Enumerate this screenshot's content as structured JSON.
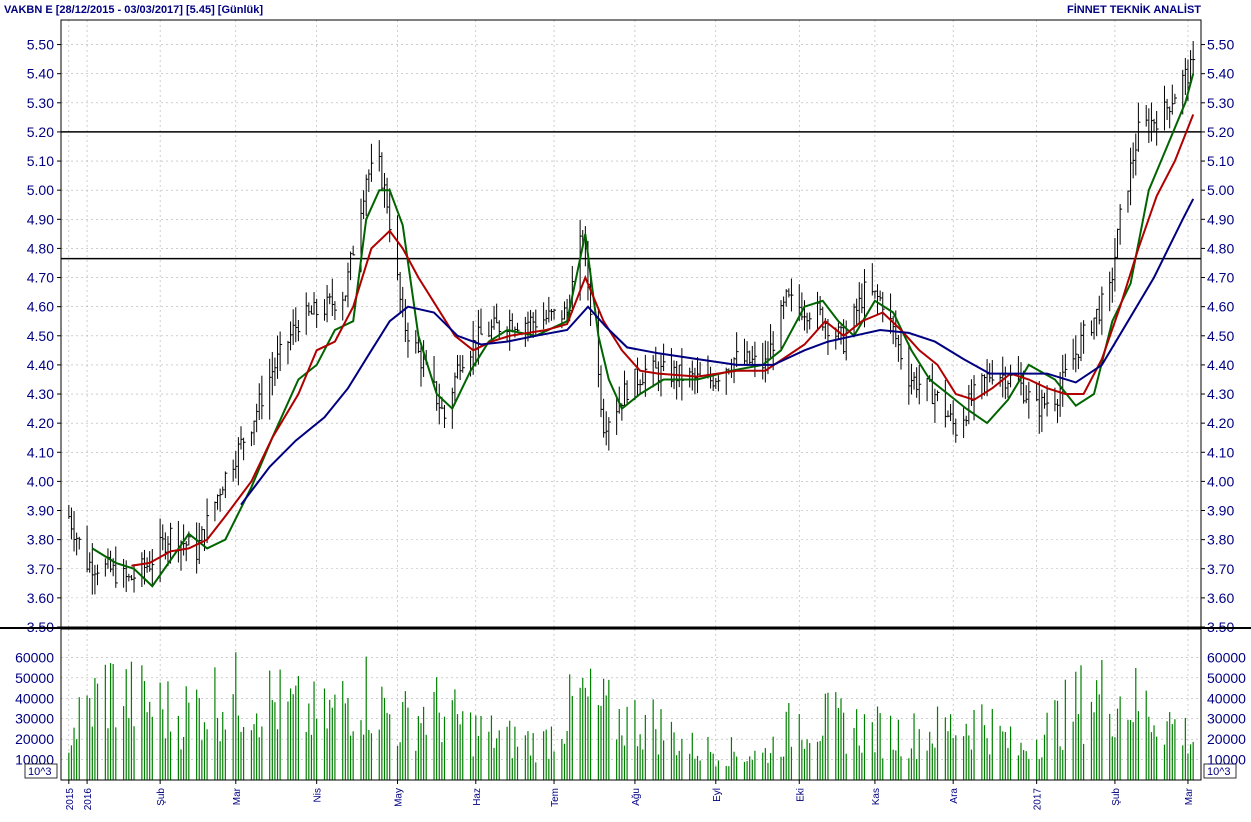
{
  "header": {
    "title": "VAKBN E  [28/12/2015 - 03/03/2017]  [5.45]  [Günlük]",
    "brand": "FİNNET TEKNİK ANALİST"
  },
  "colors": {
    "price_bars": "#000000",
    "ma_fast": "#006400",
    "ma_mid": "#b00000",
    "ma_slow": "#000080",
    "volume": "#008000",
    "grid": "#b0b0b0",
    "axis_text": "#000080"
  },
  "chart_data": [
    {
      "type": "line",
      "panel": "price",
      "title": "VAKBN E  [28/12/2015 - 03/03/2017]  [5.45]  [Günlük]",
      "ylim": [
        3.5,
        5.55
      ],
      "y_ticks": [
        "3.50",
        "3.60",
        "3.70",
        "3.80",
        "3.90",
        "4.00",
        "4.10",
        "4.20",
        "4.30",
        "4.40",
        "4.50",
        "4.60",
        "4.70",
        "4.80",
        "4.90",
        "5.00",
        "5.10",
        "5.20",
        "5.30",
        "5.40",
        "5.50"
      ],
      "x_tick_labels": [
        "2015",
        "2016",
        "Şub",
        "Mar",
        "Nis",
        "May",
        "Haz",
        "Tem",
        "Ağu",
        "Eyl",
        "Eki",
        "Kas",
        "Ara",
        "2017",
        "Şub",
        "Mar"
      ],
      "x_tick_dates": [
        "2015-12-28",
        "2016-01-04",
        "2016-02-01",
        "2016-03-01",
        "2016-04-01",
        "2016-05-02",
        "2016-06-01",
        "2016-07-01",
        "2016-08-01",
        "2016-09-01",
        "2016-10-03",
        "2016-11-01",
        "2016-12-01",
        "2017-01-02",
        "2017-02-01",
        "2017-03-01"
      ],
      "horizontal_lines": [
        5.2,
        4.765
      ],
      "price_series": {
        "dates": [
          "2015-12-28",
          "2016-01-04",
          "2016-01-12",
          "2016-01-20",
          "2016-01-28",
          "2016-02-05",
          "2016-02-15",
          "2016-02-25",
          "2016-03-07",
          "2016-03-15",
          "2016-03-25",
          "2016-04-05",
          "2016-04-12",
          "2016-04-20",
          "2016-04-25",
          "2016-04-28",
          "2016-05-04",
          "2016-05-12",
          "2016-05-20",
          "2016-05-26",
          "2016-06-03",
          "2016-06-13",
          "2016-06-24",
          "2016-07-06",
          "2016-07-12",
          "2016-07-15",
          "2016-07-20",
          "2016-07-25",
          "2016-07-29",
          "2016-08-05",
          "2016-08-15",
          "2016-08-29",
          "2016-09-08",
          "2016-09-20",
          "2016-09-28",
          "2016-10-03",
          "2016-10-10",
          "2016-10-20",
          "2016-10-28",
          "2016-11-04",
          "2016-11-14",
          "2016-11-24",
          "2016-12-02",
          "2016-12-08",
          "2016-12-16",
          "2016-12-26",
          "2017-01-02",
          "2017-01-10",
          "2017-01-20",
          "2017-01-30",
          "2017-02-03",
          "2017-02-10",
          "2017-02-20",
          "2017-02-27",
          "2017-03-03"
        ],
        "values": [
          3.88,
          3.72,
          3.7,
          3.66,
          3.72,
          3.82,
          3.76,
          4.0,
          4.2,
          4.38,
          4.55,
          4.6,
          4.65,
          5.05,
          5.08,
          4.96,
          4.55,
          4.4,
          4.22,
          4.42,
          4.5,
          4.55,
          4.55,
          4.58,
          4.85,
          4.6,
          4.2,
          4.26,
          4.32,
          4.38,
          4.37,
          4.34,
          4.42,
          4.4,
          4.62,
          4.6,
          4.58,
          4.48,
          4.65,
          4.62,
          4.36,
          4.3,
          4.18,
          4.28,
          4.38,
          4.34,
          4.25,
          4.3,
          4.5,
          4.65,
          4.9,
          5.2,
          5.27,
          5.38,
          5.42
        ]
      },
      "series": [
        {
          "dates": [
            "2016-01-06",
            "2016-01-15",
            "2016-01-22",
            "2016-01-29",
            "2016-02-05",
            "2016-02-12",
            "2016-02-19",
            "2016-02-26",
            "2016-03-07",
            "2016-03-15",
            "2016-03-25",
            "2016-04-01",
            "2016-04-08",
            "2016-04-15",
            "2016-04-20",
            "2016-04-25",
            "2016-04-29",
            "2016-05-04",
            "2016-05-10",
            "2016-05-17",
            "2016-05-23",
            "2016-05-30",
            "2016-06-06",
            "2016-06-13",
            "2016-06-24",
            "2016-07-06",
            "2016-07-13",
            "2016-07-18",
            "2016-07-22",
            "2016-07-27",
            "2016-08-03",
            "2016-08-12",
            "2016-08-25",
            "2016-09-07",
            "2016-09-19",
            "2016-09-26",
            "2016-10-05",
            "2016-10-12",
            "2016-10-18",
            "2016-10-24",
            "2016-11-01",
            "2016-11-08",
            "2016-11-15",
            "2016-11-22",
            "2016-11-29",
            "2016-12-06",
            "2016-12-14",
            "2016-12-22",
            "2016-12-30",
            "2017-01-09",
            "2017-01-17",
            "2017-01-24",
            "2017-01-31",
            "2017-02-07",
            "2017-02-14",
            "2017-02-21",
            "2017-02-28",
            "2017-03-03"
          ],
          "values": [
            3.77,
            3.72,
            3.7,
            3.64,
            3.73,
            3.82,
            3.77,
            3.8,
            3.98,
            4.15,
            4.35,
            4.4,
            4.52,
            4.55,
            4.9,
            5.0,
            5.0,
            4.88,
            4.5,
            4.3,
            4.25,
            4.38,
            4.48,
            4.52,
            4.5,
            4.55,
            4.85,
            4.5,
            4.35,
            4.25,
            4.3,
            4.35,
            4.35,
            4.38,
            4.4,
            4.45,
            4.6,
            4.62,
            4.55,
            4.5,
            4.62,
            4.58,
            4.45,
            4.35,
            4.3,
            4.25,
            4.2,
            4.28,
            4.4,
            4.35,
            4.26,
            4.3,
            4.55,
            4.68,
            5.0,
            5.15,
            5.3,
            5.4
          ]
        },
        {
          "dates": [
            "2016-01-21",
            "2016-01-28",
            "2016-02-05",
            "2016-02-12",
            "2016-02-19",
            "2016-02-26",
            "2016-03-07",
            "2016-03-15",
            "2016-03-25",
            "2016-04-01",
            "2016-04-08",
            "2016-04-15",
            "2016-04-22",
            "2016-04-29",
            "2016-05-04",
            "2016-05-10",
            "2016-05-17",
            "2016-05-24",
            "2016-05-31",
            "2016-06-07",
            "2016-06-14",
            "2016-06-28",
            "2016-07-06",
            "2016-07-13",
            "2016-07-20",
            "2016-07-27",
            "2016-08-03",
            "2016-08-10",
            "2016-08-25",
            "2016-09-09",
            "2016-09-20",
            "2016-10-05",
            "2016-10-13",
            "2016-10-20",
            "2016-10-27",
            "2016-11-04",
            "2016-11-11",
            "2016-11-18",
            "2016-11-25",
            "2016-12-02",
            "2016-12-09",
            "2016-12-16",
            "2016-12-23",
            "2016-12-30",
            "2017-01-06",
            "2017-01-13",
            "2017-01-20",
            "2017-01-27",
            "2017-02-03",
            "2017-02-10",
            "2017-02-17",
            "2017-02-24",
            "2017-03-03"
          ],
          "values": [
            3.71,
            3.72,
            3.76,
            3.77,
            3.8,
            3.88,
            4.0,
            4.15,
            4.3,
            4.45,
            4.48,
            4.6,
            4.8,
            4.86,
            4.8,
            4.7,
            4.6,
            4.5,
            4.45,
            4.48,
            4.5,
            4.52,
            4.54,
            4.7,
            4.55,
            4.45,
            4.38,
            4.37,
            4.36,
            4.38,
            4.38,
            4.47,
            4.55,
            4.5,
            4.55,
            4.58,
            4.52,
            4.45,
            4.4,
            4.3,
            4.28,
            4.32,
            4.37,
            4.35,
            4.32,
            4.3,
            4.3,
            4.42,
            4.6,
            4.8,
            4.98,
            5.1,
            5.26
          ]
        },
        {
          "dates": [
            "2016-03-03",
            "2016-03-14",
            "2016-03-24",
            "2016-04-04",
            "2016-04-13",
            "2016-04-22",
            "2016-04-29",
            "2016-05-06",
            "2016-05-16",
            "2016-05-25",
            "2016-06-03",
            "2016-06-13",
            "2016-06-24",
            "2016-07-06",
            "2016-07-14",
            "2016-07-21",
            "2016-07-29",
            "2016-08-10",
            "2016-08-25",
            "2016-09-09",
            "2016-09-23",
            "2016-10-05",
            "2016-10-14",
            "2016-10-24",
            "2016-11-03",
            "2016-11-14",
            "2016-11-24",
            "2016-12-05",
            "2016-12-15",
            "2016-12-26",
            "2017-01-06",
            "2017-01-17",
            "2017-01-27",
            "2017-02-06",
            "2017-02-16",
            "2017-02-27",
            "2017-03-03"
          ],
          "values": [
            3.92,
            4.05,
            4.14,
            4.22,
            4.32,
            4.45,
            4.55,
            4.6,
            4.58,
            4.5,
            4.47,
            4.48,
            4.5,
            4.52,
            4.6,
            4.53,
            4.46,
            4.44,
            4.42,
            4.4,
            4.4,
            4.45,
            4.48,
            4.5,
            4.52,
            4.51,
            4.48,
            4.42,
            4.37,
            4.37,
            4.37,
            4.34,
            4.4,
            4.55,
            4.7,
            4.9,
            4.97
          ]
        }
      ]
    },
    {
      "type": "bar",
      "panel": "volume",
      "ylim": [
        0,
        70000
      ],
      "y_ticks": [
        "10000",
        "20000",
        "30000",
        "40000",
        "50000",
        "60000"
      ],
      "unit_label": "10^3",
      "dates": [
        "2015-12-28",
        "2016-01-11",
        "2016-01-25",
        "2016-02-08",
        "2016-02-22",
        "2016-03-07",
        "2016-03-21",
        "2016-04-04",
        "2016-04-18",
        "2016-05-02",
        "2016-05-16",
        "2016-05-30",
        "2016-06-13",
        "2016-06-27",
        "2016-07-11",
        "2016-07-25",
        "2016-08-08",
        "2016-08-22",
        "2016-09-05",
        "2016-09-19",
        "2016-10-03",
        "2016-10-17",
        "2016-10-31",
        "2016-11-14",
        "2016-11-28",
        "2016-12-12",
        "2016-12-26",
        "2017-01-09",
        "2017-01-23",
        "2017-02-06",
        "2017-02-20",
        "2017-03-03"
      ],
      "values": [
        22000,
        45000,
        38000,
        32000,
        40000,
        42000,
        35000,
        30000,
        45000,
        28000,
        35000,
        25000,
        20000,
        18000,
        40000,
        30000,
        28000,
        16000,
        14000,
        12000,
        30000,
        28000,
        24000,
        22000,
        25000,
        30000,
        14000,
        28000,
        42000,
        40000,
        30000,
        20000
      ]
    }
  ]
}
